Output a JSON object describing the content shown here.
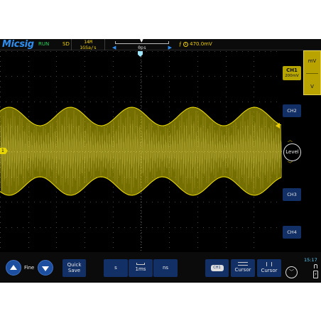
{
  "topbar": {
    "brand": "Micsig",
    "run_status": "RUN",
    "acq_mode": "SD",
    "memory_depth": "14M",
    "sample_rate": "1GSa/s",
    "horizontal_position": "0ps",
    "trigger_info": "470.0mV",
    "trigger_slope_icon": "rising-edge-icon",
    "trigger_source_icon": "ch1-source-icon"
  },
  "channels": {
    "ch1_label": "CH1",
    "ch1_scale": "200mV",
    "ch2_label": "CH2",
    "ch3_label": "CH3",
    "ch4_label": "CH4",
    "ch1_marker": "1"
  },
  "scale_panel": {
    "unit_top": "mV",
    "unit_bottom": "V"
  },
  "trigger_level": {
    "label": "Level"
  },
  "bottombar": {
    "fine_label": "Fine",
    "quick_save_line1": "Quick",
    "quick_save_line2": "Save",
    "timebase_left": "s",
    "timebase_value": "1ms",
    "timebase_right": "ns",
    "source_chip": "CH1",
    "cursor1_label": "Cursor",
    "cursor2_label": "Cursor",
    "clock": "15:17"
  },
  "waveform": {
    "type": "amplitude-modulated-sine",
    "color": "#d6c800",
    "envelope_peaks": 5
  },
  "colors": {
    "accent": "#2f8ff0",
    "trace": "#e6d500",
    "button": "#123066",
    "active": "#b7a500"
  }
}
